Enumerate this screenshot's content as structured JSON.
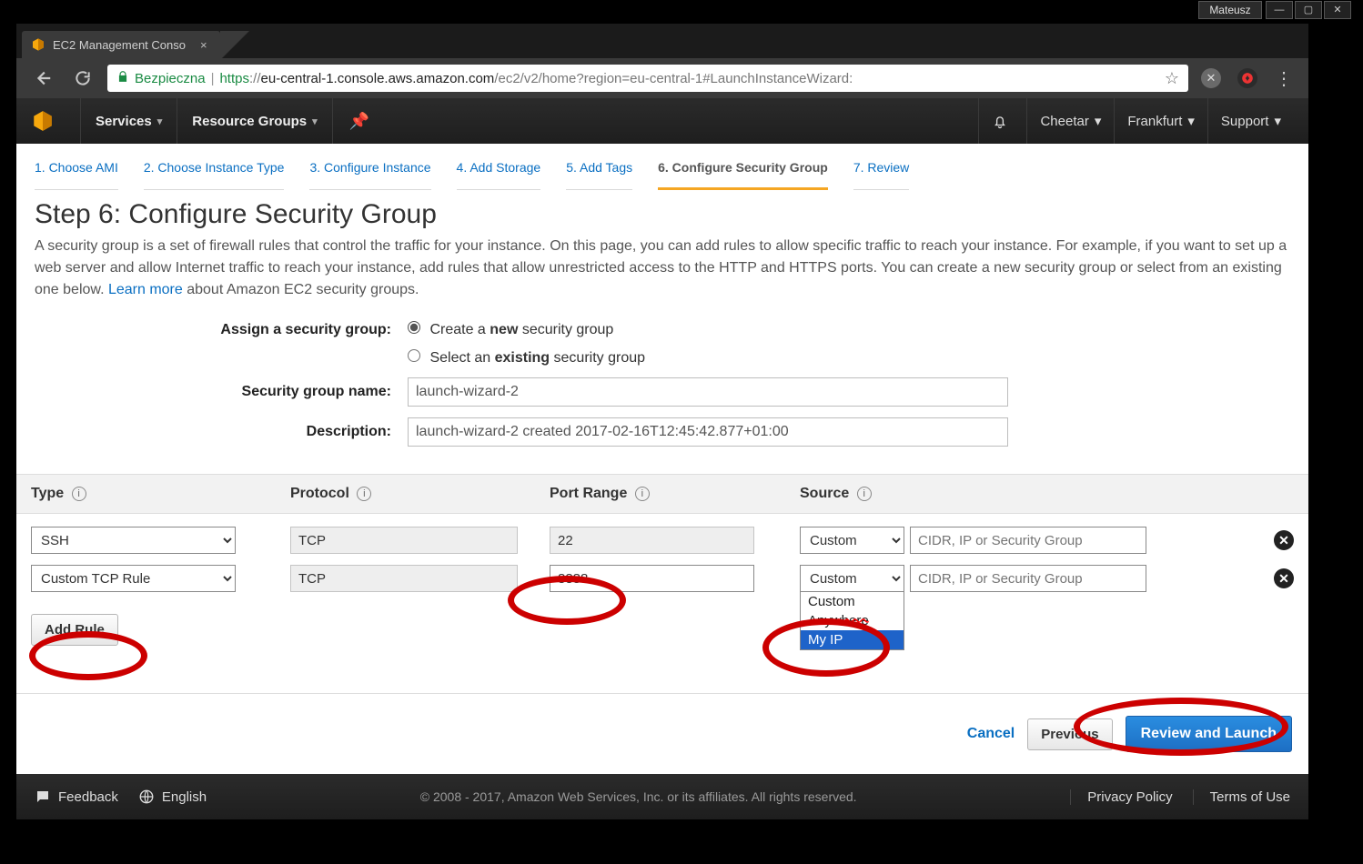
{
  "os": {
    "username": "Mateusz",
    "min": "—",
    "max": "▢",
    "close": "✕"
  },
  "browser": {
    "tab_title": "EC2 Management Conso",
    "tab_close": "×",
    "url": {
      "safe_label": "Bezpieczna",
      "scheme": "https",
      "domain": "eu-central-1.console.aws.amazon.com",
      "path": "/ec2/v2/home?region=eu-central-1#LaunchInstanceWizard:"
    }
  },
  "aws_header": {
    "services": "Services",
    "resource_groups": "Resource Groups",
    "account": "Cheetar",
    "region": "Frankfurt",
    "support": "Support"
  },
  "wizard_steps": [
    "1. Choose AMI",
    "2. Choose Instance Type",
    "3. Configure Instance",
    "4. Add Storage",
    "5. Add Tags",
    "6. Configure Security Group",
    "7. Review"
  ],
  "active_step_index": 5,
  "heading": "Step 6: Configure Security Group",
  "description_pre": "A security group is a set of firewall rules that control the traffic for your instance. On this page, you can add rules to allow specific traffic to reach your instance. For example, if you want to set up a web server and allow Internet traffic to reach your instance, add rules that allow unrestricted access to the HTTP and HTTPS ports. You can create a new security group or select from an existing one below. ",
  "description_link": "Learn more",
  "description_post": " about Amazon EC2 security groups.",
  "form": {
    "assign_label": "Assign a security group:",
    "radio_create_pre": "Create a ",
    "radio_create_bold": "new",
    "radio_create_post": " security group",
    "radio_existing_pre": "Select an ",
    "radio_existing_bold": "existing",
    "radio_existing_post": " security group",
    "name_label": "Security group name:",
    "name_value": "launch-wizard-2",
    "desc_label": "Description:",
    "desc_value": "launch-wizard-2 created 2017-02-16T12:45:42.877+01:00"
  },
  "table": {
    "headers": {
      "type": "Type",
      "protocol": "Protocol",
      "port": "Port Range",
      "source": "Source"
    },
    "info_glyph": "i",
    "source_placeholder": "CIDR, IP or Security Group",
    "rows": [
      {
        "type": "SSH",
        "protocol": "TCP",
        "port": "22",
        "port_editable": false,
        "source_mode": "Custom",
        "cidr": ""
      },
      {
        "type": "Custom TCP Rule",
        "protocol": "TCP",
        "port": "8888",
        "port_editable": true,
        "source_mode": "Custom",
        "cidr": ""
      }
    ],
    "dropdown_options": [
      "Custom",
      "Anywhere",
      "My IP"
    ],
    "dropdown_selected_index": 2,
    "add_rule": "Add Rule"
  },
  "actions": {
    "cancel": "Cancel",
    "previous": "Previous",
    "review": "Review and Launch"
  },
  "footer": {
    "feedback": "Feedback",
    "language": "English",
    "copyright": "© 2008 - 2017, Amazon Web Services, Inc. or its affiliates. All rights reserved.",
    "privacy": "Privacy Policy",
    "terms": "Terms of Use"
  }
}
